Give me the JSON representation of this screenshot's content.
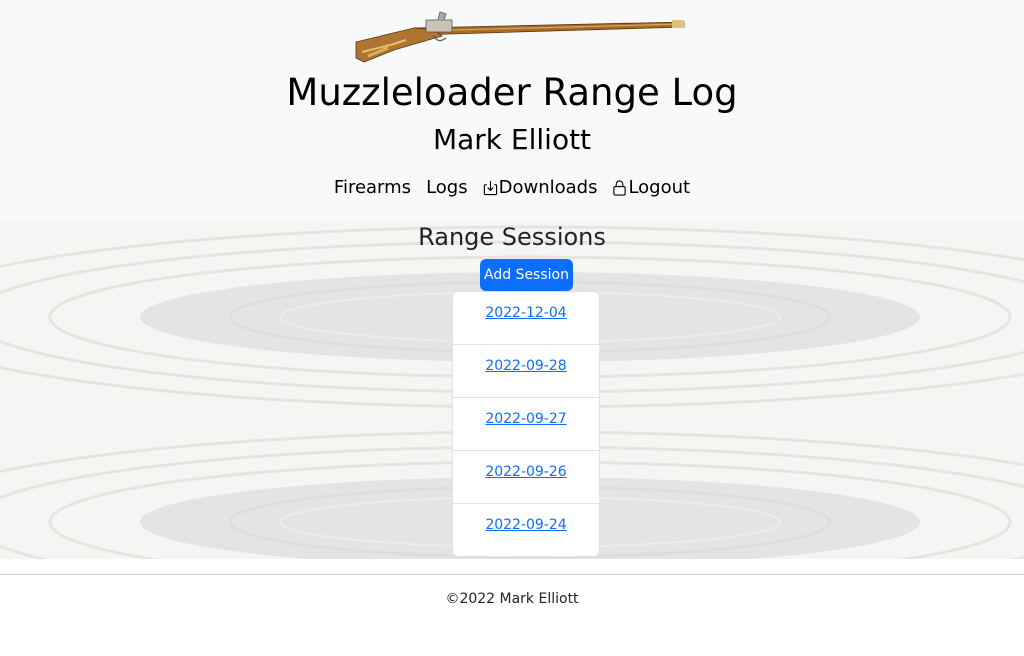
{
  "header": {
    "title": "Muzzleloader Range Log",
    "user_name": "Mark Elliott"
  },
  "nav": {
    "items": [
      {
        "label": "Firearms",
        "icon": ""
      },
      {
        "label": "Logs",
        "icon": ""
      },
      {
        "label": "Downloads",
        "icon": "download-icon"
      },
      {
        "label": "Logout",
        "icon": "lock-icon"
      }
    ]
  },
  "main": {
    "title": "Range Sessions",
    "add_button": "Add Session",
    "sessions": [
      "2022-12-04",
      "2022-09-28",
      "2022-09-27",
      "2022-09-26",
      "2022-09-24"
    ]
  },
  "footer": {
    "copyright": "©2022 Mark Elliott"
  },
  "colors": {
    "header_bg": "#f8f9fa",
    "primary": "#0d6efd",
    "link": "#0d6efd"
  }
}
